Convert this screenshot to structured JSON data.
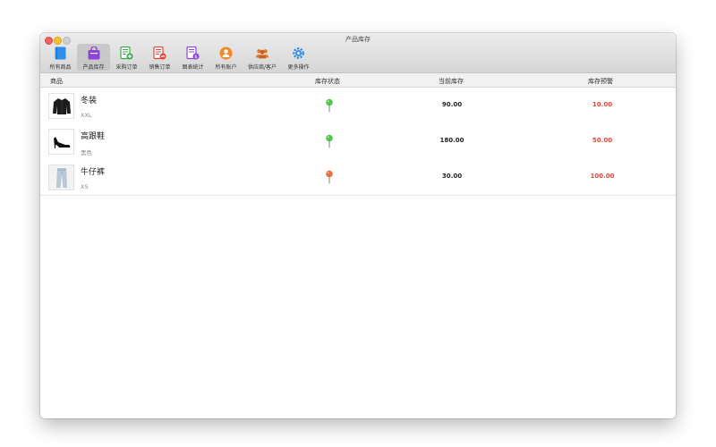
{
  "window": {
    "title": "产品库存"
  },
  "toolbar": [
    {
      "label": "所有商品",
      "icon": "book-icon",
      "color": "#2f8ee8",
      "active": false
    },
    {
      "label": "产品库存",
      "icon": "bag-icon",
      "color": "#8e44d6",
      "active": true
    },
    {
      "label": "采购订单",
      "icon": "purchase-order-icon",
      "color": "#3aa94a",
      "active": false
    },
    {
      "label": "销售订单",
      "icon": "sales-order-icon",
      "color": "#e0483b",
      "active": false
    },
    {
      "label": "图表统计",
      "icon": "chart-stats-icon",
      "color": "#8e44d6",
      "active": false
    },
    {
      "label": "所有账户",
      "icon": "account-icon",
      "color": "#f08a2a",
      "active": false
    },
    {
      "label": "供应商/客户",
      "icon": "people-icon",
      "color": "#e07a2a",
      "active": false
    },
    {
      "label": "更多操作",
      "icon": "gear-icon",
      "color": "#2f8ee8",
      "active": false
    }
  ],
  "table": {
    "headers": {
      "product": "商品",
      "status": "库存状态",
      "current": "当前库存",
      "warning": "库存预警"
    },
    "rows": [
      {
        "name": "冬装",
        "sub": "XXL",
        "thumb": "jacket-image",
        "status_color": "#54c24a",
        "current": "90.00",
        "warning": "10.00"
      },
      {
        "name": "高跟鞋",
        "sub": "黑色",
        "thumb": "high-heel-image",
        "status_color": "#54c24a",
        "current": "180.00",
        "warning": "50.00"
      },
      {
        "name": "牛仔裤",
        "sub": "XS",
        "thumb": "jeans-image",
        "status_color": "#e5703a",
        "current": "30.00",
        "warning": "100.00"
      }
    ]
  }
}
